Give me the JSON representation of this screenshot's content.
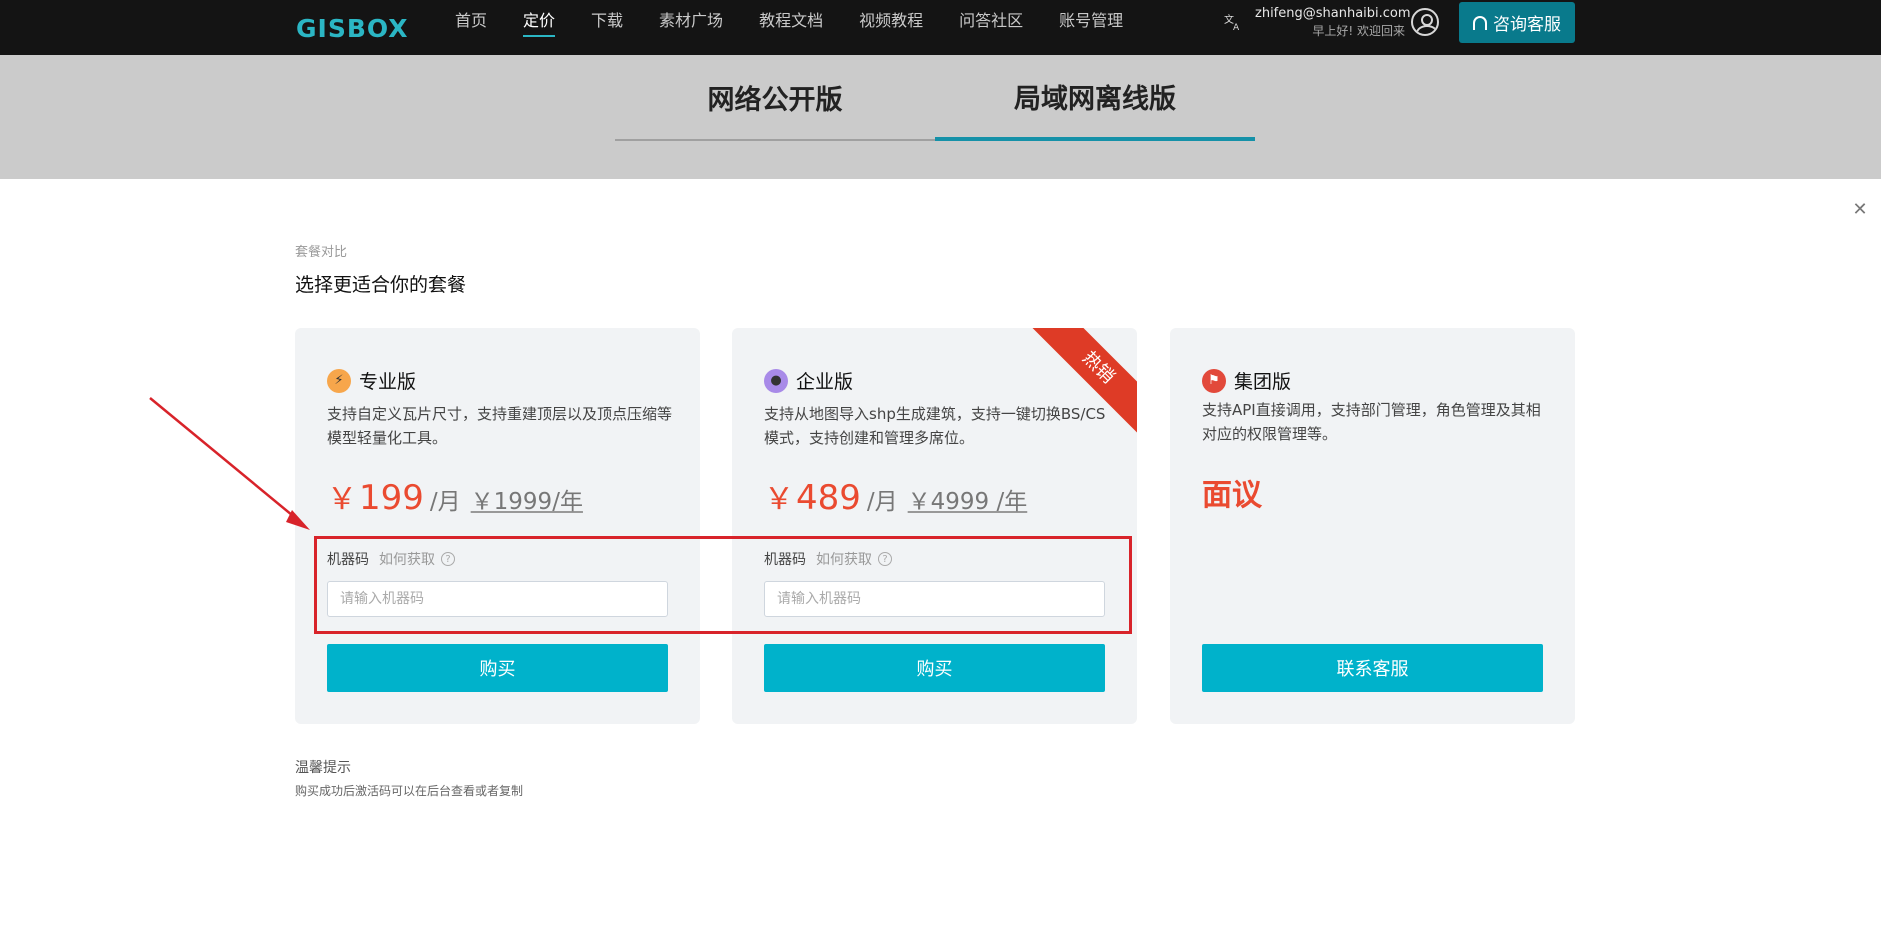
{
  "brand": {
    "logo_text": "GISBOX",
    "accent": "#2bb6c4"
  },
  "nav": {
    "items": [
      {
        "label": "首页",
        "active": false
      },
      {
        "label": "定价",
        "active": true
      },
      {
        "label": "下载",
        "active": false
      },
      {
        "label": "素材广场",
        "active": false
      },
      {
        "label": "教程文档",
        "active": false
      },
      {
        "label": "视频教程",
        "active": false
      },
      {
        "label": "问答社区",
        "active": false
      },
      {
        "label": "账号管理",
        "active": false
      }
    ],
    "lang_icon": "translate-icon"
  },
  "user": {
    "email": "zhifeng@shanhaibi.com",
    "greeting": "早上好! 欢迎回来"
  },
  "header": {
    "consult_label": "咨询客服"
  },
  "version_tabs": [
    {
      "label": "网络公开版",
      "active": false
    },
    {
      "label": "局域网离线版",
      "active": true
    }
  ],
  "main": {
    "eyebrow": "套餐对比",
    "heading": "选择更适合你的套餐"
  },
  "plans": [
    {
      "name": "专业版",
      "icon": "lightning-icon",
      "description": "支持自定义瓦片尺寸，支持重建顶层以及顶点压缩等模型轻量化工具。",
      "currency": "￥",
      "price": "199",
      "unit": "/月",
      "old_price": "￥1999/年",
      "machine_code_label": "机器码",
      "how_to_get": "如何获取",
      "input_placeholder": "请输入机器码",
      "button_label": "购买"
    },
    {
      "name": "企业版",
      "icon": "medal-icon",
      "badge": "热销",
      "description": "支持从地图导入shp生成建筑，支持一键切换BS/CS模式，支持创建和管理多席位。",
      "currency": "￥",
      "price": "489",
      "unit": "/月",
      "old_price": "￥4999 /年",
      "machine_code_label": "机器码",
      "how_to_get": "如何获取",
      "input_placeholder": "请输入机器码",
      "button_label": "购买"
    },
    {
      "name": "集团版",
      "icon": "flag-icon",
      "description": "支持API直接调用，支持部门管理，角色管理及其相对应的权限管理等。",
      "price_text": "面议",
      "button_label": "联系客服"
    }
  ],
  "tips": {
    "title": "温馨提示",
    "text": "购买成功后激活码可以在后台查看或者复制"
  },
  "colors": {
    "primary_button": "#00b2cb",
    "price_red": "#ea4a30",
    "highlight_red": "#d8232a",
    "consult_button": "#097a8c"
  }
}
